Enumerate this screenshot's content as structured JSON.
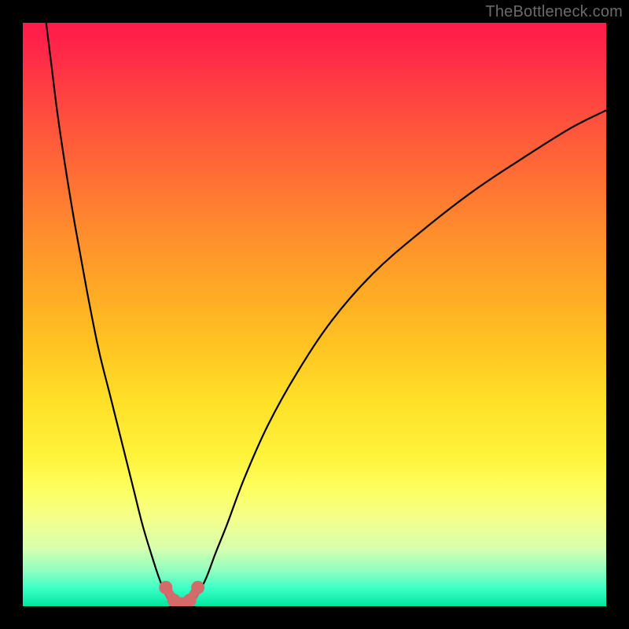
{
  "attribution": "TheBottleneck.com",
  "chart_data": {
    "type": "line",
    "title": "",
    "xlabel": "",
    "ylabel": "",
    "xlim": [
      0,
      100
    ],
    "ylim": [
      0,
      100
    ],
    "series": [
      {
        "name": "left-curve",
        "x": [
          4,
          5,
          6,
          7.5,
          9,
          11,
          13,
          15,
          17,
          19,
          20.5,
          22,
          23.3,
          24.5,
          25.5
        ],
        "y": [
          100,
          92,
          84,
          74,
          65,
          54,
          44,
          36,
          28,
          20,
          14,
          9,
          5,
          2,
          0.3
        ]
      },
      {
        "name": "right-curve",
        "x": [
          29,
          30,
          31.5,
          33,
          35,
          38,
          42,
          47,
          53,
          60,
          68,
          77,
          86,
          94,
          100
        ],
        "y": [
          0.3,
          2,
          5,
          9,
          14,
          22,
          31,
          40,
          49,
          57,
          64,
          71,
          77,
          82,
          85
        ]
      },
      {
        "name": "valley-floor-markers",
        "x": [
          24.5,
          25.9,
          27.2,
          28.6,
          30.0
        ],
        "y": [
          3.2,
          1.0,
          0.4,
          1.0,
          3.2
        ]
      }
    ],
    "marker_color": "#d46a6a",
    "curve_color": "#000000",
    "gradient_stops": [
      {
        "pos": 0,
        "color": "#ff1a4a"
      },
      {
        "pos": 50,
        "color": "#ffb426"
      },
      {
        "pos": 80,
        "color": "#fdff60"
      },
      {
        "pos": 100,
        "color": "#00e6a0"
      }
    ]
  }
}
